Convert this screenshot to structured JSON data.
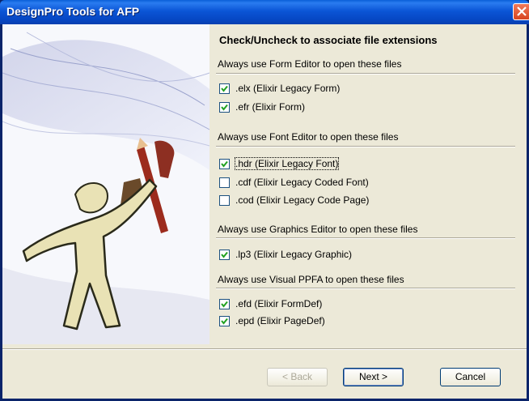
{
  "window": {
    "title": "DesignPro Tools for AFP"
  },
  "heading": "Check/Uncheck to associate file extensions",
  "groups": [
    {
      "label": "Always use Form Editor to open these files",
      "items": [
        {
          "label": ".elx (Elixir Legacy Form)",
          "checked": true
        },
        {
          "label": ".efr (Elixir Form)",
          "checked": true
        }
      ]
    },
    {
      "label": "Always use Font Editor to open these files",
      "items": [
        {
          "label": ".hdr (Elixir Legacy Font)",
          "checked": true
        },
        {
          "label": ".cdf (Elixir Legacy Coded Font)",
          "checked": false
        },
        {
          "label": ".cod (Elixir Legacy Code Page)",
          "checked": false
        }
      ]
    },
    {
      "label": "Always use Graphics Editor to open these files",
      "items": [
        {
          "label": ".lp3 (Elixir Legacy Graphic)",
          "checked": true
        }
      ]
    },
    {
      "label": "Always use Visual PPFA to open these files",
      "items": [
        {
          "label": ".efd (Elixir FormDef)",
          "checked": true
        },
        {
          "label": ".epd (Elixir PageDef)",
          "checked": true
        }
      ]
    }
  ],
  "buttons": {
    "back": {
      "label": "< Back",
      "enabled": false
    },
    "next": {
      "label": "Next >",
      "enabled": true
    },
    "cancel": {
      "label": "Cancel",
      "enabled": true
    }
  },
  "colors": {
    "titlebar": "#0b55d6",
    "close": "#d8451f",
    "dialog": "#ece9d8"
  }
}
